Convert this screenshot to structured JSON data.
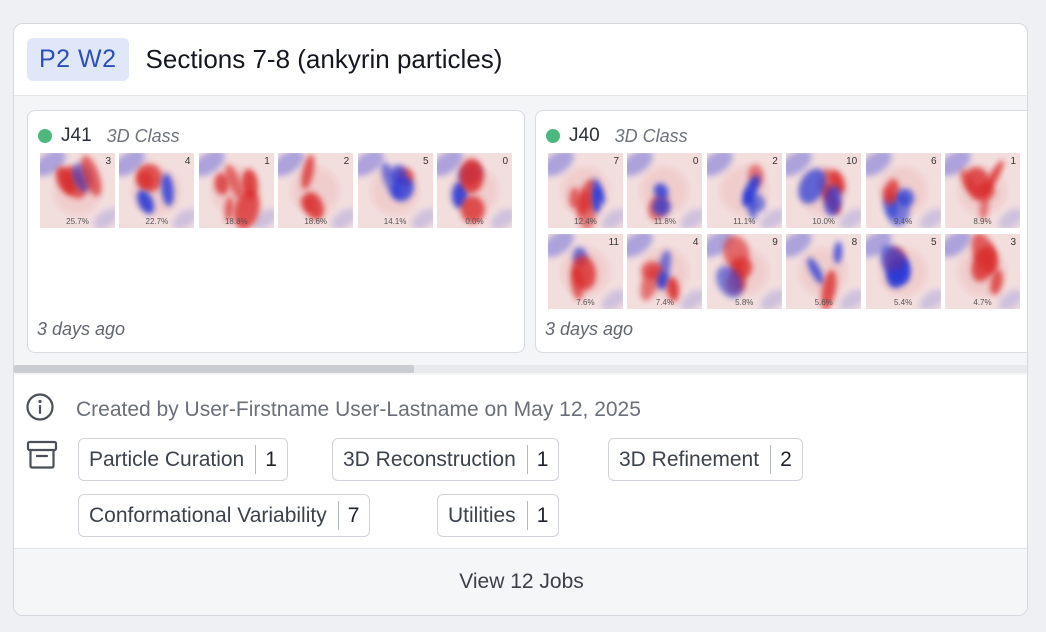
{
  "header": {
    "badge": "P2 W2",
    "title": "Sections 7-8 (ankyrin particles)"
  },
  "jobs": [
    {
      "id": "J41",
      "type": "3D Class",
      "status_color": "#4cb87d",
      "time": "3 days ago",
      "classes": [
        {
          "num": "3",
          "pct": "25.7%"
        },
        {
          "num": "4",
          "pct": "22.7%"
        },
        {
          "num": "1",
          "pct": "18.8%"
        },
        {
          "num": "2",
          "pct": "18.6%"
        },
        {
          "num": "5",
          "pct": "14.1%"
        },
        {
          "num": "0",
          "pct": "0.0%"
        }
      ]
    },
    {
      "id": "J40",
      "type": "3D Class",
      "status_color": "#4cb87d",
      "time": "3 days ago",
      "classes": [
        {
          "num": "7",
          "pct": "12.4%"
        },
        {
          "num": "0",
          "pct": "11.8%"
        },
        {
          "num": "2",
          "pct": "11.1%"
        },
        {
          "num": "10",
          "pct": "10.0%"
        },
        {
          "num": "6",
          "pct": "9.4%"
        },
        {
          "num": "1",
          "pct": "8.9%"
        },
        {
          "num": "11",
          "pct": "7.6%"
        },
        {
          "num": "4",
          "pct": "7.4%"
        },
        {
          "num": "9",
          "pct": "5.8%"
        },
        {
          "num": "8",
          "pct": "5.6%"
        },
        {
          "num": "5",
          "pct": "5.4%"
        },
        {
          "num": "3",
          "pct": "4.7%"
        }
      ]
    }
  ],
  "meta": {
    "created_text": "Created by User-Firstname User-Lastname on May 12, 2025",
    "info_icon": "info-circle-icon",
    "archive_icon": "archive-box-icon"
  },
  "tags": [
    {
      "label": "Particle Curation",
      "count": "1"
    },
    {
      "label": "3D Reconstruction",
      "count": "1"
    },
    {
      "label": "3D Refinement",
      "count": "2"
    },
    {
      "label": "Conformational Variability",
      "count": "7"
    },
    {
      "label": "Utilities",
      "count": "1"
    }
  ],
  "footer": {
    "label": "View 12 Jobs"
  },
  "colors": {
    "badge_bg": "#dfe7f8",
    "badge_text": "#2c4fb8",
    "status_green": "#4cb87d",
    "map_red": "#d92a2a",
    "map_blue": "#2436d6"
  }
}
